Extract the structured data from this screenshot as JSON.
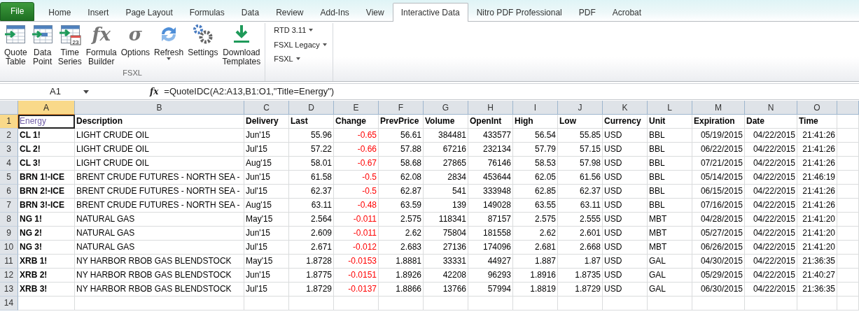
{
  "tabs": [
    {
      "label": "File",
      "kind": "file",
      "selected": false
    },
    {
      "label": "Home",
      "kind": "tab",
      "selected": false
    },
    {
      "label": "Insert",
      "kind": "tab",
      "selected": false
    },
    {
      "label": "Page Layout",
      "kind": "tab",
      "selected": false
    },
    {
      "label": "Formulas",
      "kind": "tab",
      "selected": false
    },
    {
      "label": "Data",
      "kind": "tab",
      "selected": false
    },
    {
      "label": "Review",
      "kind": "tab",
      "selected": false
    },
    {
      "label": "Add-Ins",
      "kind": "tab",
      "selected": false
    },
    {
      "label": "View",
      "kind": "tab",
      "selected": false
    },
    {
      "label": "Interactive Data",
      "kind": "tab",
      "selected": true
    },
    {
      "label": "Nitro PDF Professional",
      "kind": "tab",
      "selected": false
    },
    {
      "label": "PDF",
      "kind": "tab",
      "selected": false
    },
    {
      "label": "Acrobat",
      "kind": "tab",
      "selected": false
    }
  ],
  "ribbon": {
    "group_label": "FSXL",
    "buttons": [
      {
        "label": [
          "Quote",
          "Table"
        ],
        "kind": "table"
      },
      {
        "label": [
          "Data",
          "Point"
        ],
        "kind": "point"
      },
      {
        "label": [
          "Time",
          "Series"
        ],
        "kind": "series",
        "badge": "23"
      },
      {
        "label": [
          "Formula",
          "Builder"
        ],
        "kind": "glyph",
        "glyph": "fx"
      },
      {
        "label": [
          "Options"
        ],
        "kind": "glyph",
        "glyph": "σ"
      },
      {
        "label": [
          "Refresh"
        ],
        "kind": "refresh",
        "dropdown": true
      },
      {
        "label": [
          "Settings"
        ],
        "kind": "gears"
      },
      {
        "label": [
          "Download",
          "Templates"
        ],
        "kind": "download"
      }
    ],
    "menus": [
      "RTD 3.11",
      "FSXL Legacy",
      "FSXL"
    ]
  },
  "formula_bar": {
    "name_box": "A1",
    "fx": "fx",
    "formula": "=QuoteIDC(A2:A13,B1:O1,\"Title=Energy\")"
  },
  "sheet": {
    "columns": [
      {
        "letter": "A",
        "kind": "label",
        "selected": true
      },
      {
        "letter": "B",
        "kind": "text",
        "selected": false
      },
      {
        "letter": "C",
        "kind": "text",
        "selected": false
      },
      {
        "letter": "D",
        "kind": "number",
        "selected": false
      },
      {
        "letter": "E",
        "kind": "change",
        "selected": false
      },
      {
        "letter": "F",
        "kind": "number",
        "selected": false
      },
      {
        "letter": "G",
        "kind": "number",
        "selected": false
      },
      {
        "letter": "H",
        "kind": "number",
        "selected": false
      },
      {
        "letter": "I",
        "kind": "number",
        "selected": false
      },
      {
        "letter": "J",
        "kind": "number",
        "selected": false
      },
      {
        "letter": "K",
        "kind": "text",
        "selected": false
      },
      {
        "letter": "L",
        "kind": "text",
        "selected": false
      },
      {
        "letter": "M",
        "kind": "number",
        "selected": false
      },
      {
        "letter": "N",
        "kind": "number",
        "selected": false
      },
      {
        "letter": "O",
        "kind": "number",
        "selected": false
      }
    ],
    "rows": [
      {
        "number": "1",
        "kind": "header",
        "selected": true,
        "cells": [
          "Energy",
          "Description",
          "Delivery",
          "Last",
          "Change",
          "PrevPrice",
          "Volume",
          "OpenInt",
          "High",
          "Low",
          "Currency",
          "Unit",
          "Expiration",
          "Date",
          "Time"
        ]
      },
      {
        "number": "2",
        "kind": "data",
        "selected": false,
        "cells": [
          "CL 1!",
          "LIGHT CRUDE OIL",
          "Jun'15",
          "55.96",
          "-0.65",
          "56.61",
          "384481",
          "433577",
          "56.54",
          "55.85",
          "USD",
          "BBL",
          "05/19/2015",
          "04/22/2015",
          "21:41:26"
        ]
      },
      {
        "number": "3",
        "kind": "data",
        "selected": false,
        "cells": [
          "CL 2!",
          "LIGHT CRUDE OIL",
          "Jul'15",
          "57.22",
          "-0.66",
          "57.88",
          "67216",
          "232134",
          "57.79",
          "57.15",
          "USD",
          "BBL",
          "06/22/2015",
          "04/22/2015",
          "21:41:26"
        ]
      },
      {
        "number": "4",
        "kind": "data",
        "selected": false,
        "cells": [
          "CL 3!",
          "LIGHT CRUDE OIL",
          "Aug'15",
          "58.01",
          "-0.67",
          "58.68",
          "27865",
          "76146",
          "58.53",
          "57.98",
          "USD",
          "BBL",
          "07/21/2015",
          "04/22/2015",
          "21:41:26"
        ]
      },
      {
        "number": "5",
        "kind": "data",
        "selected": false,
        "cells": [
          "BRN 1!-ICE",
          "BRENT CRUDE FUTURES - NORTH SEA -",
          "Jun'15",
          "61.58",
          "-0.5",
          "62.08",
          "2834",
          "453644",
          "62.05",
          "61.56",
          "USD",
          "BBL",
          "05/14/2015",
          "04/22/2015",
          "21:46:19"
        ]
      },
      {
        "number": "6",
        "kind": "data",
        "selected": false,
        "cells": [
          "BRN 2!-ICE",
          "BRENT CRUDE FUTURES - NORTH SEA -",
          "Jul'15",
          "62.37",
          "-0.5",
          "62.87",
          "541",
          "333948",
          "62.85",
          "62.37",
          "USD",
          "BBL",
          "06/15/2015",
          "04/22/2015",
          "21:41:26"
        ]
      },
      {
        "number": "7",
        "kind": "data",
        "selected": false,
        "cells": [
          "BRN 3!-ICE",
          "BRENT CRUDE FUTURES - NORTH SEA -",
          "Aug'15",
          "63.11",
          "-0.48",
          "63.59",
          "139",
          "149028",
          "63.55",
          "63.11",
          "USD",
          "BBL",
          "07/16/2015",
          "04/22/2015",
          "21:41:26"
        ]
      },
      {
        "number": "8",
        "kind": "data",
        "selected": false,
        "cells": [
          "NG 1!",
          "NATURAL GAS",
          "May'15",
          "2.564",
          "-0.011",
          "2.575",
          "118341",
          "87157",
          "2.575",
          "2.555",
          "USD",
          "MBT",
          "04/28/2015",
          "04/22/2015",
          "21:41:20"
        ]
      },
      {
        "number": "9",
        "kind": "data",
        "selected": false,
        "cells": [
          "NG 2!",
          "NATURAL GAS",
          "Jun'15",
          "2.609",
          "-0.011",
          "2.62",
          "75804",
          "181558",
          "2.62",
          "2.601",
          "USD",
          "MBT",
          "05/27/2015",
          "04/22/2015",
          "21:41:20"
        ]
      },
      {
        "number": "10",
        "kind": "data",
        "selected": false,
        "cells": [
          "NG 3!",
          "NATURAL GAS",
          "Jul'15",
          "2.671",
          "-0.012",
          "2.683",
          "27136",
          "174096",
          "2.681",
          "2.668",
          "USD",
          "MBT",
          "06/26/2015",
          "04/22/2015",
          "21:41:20"
        ]
      },
      {
        "number": "11",
        "kind": "data",
        "selected": false,
        "cells": [
          "XRB 1!",
          "NY HARBOR RBOB GAS BLENDSTOCK",
          "May'15",
          "1.8728",
          "-0.0153",
          "1.8881",
          "33331",
          "44927",
          "1.887",
          "1.87",
          "USD",
          "GAL",
          "04/30/2015",
          "04/22/2015",
          "21:36:35"
        ]
      },
      {
        "number": "12",
        "kind": "data",
        "selected": false,
        "cells": [
          "XRB 2!",
          "NY HARBOR RBOB GAS BLENDSTOCK",
          "Jun'15",
          "1.8775",
          "-0.0151",
          "1.8926",
          "42208",
          "96293",
          "1.8916",
          "1.8735",
          "USD",
          "GAL",
          "05/29/2015",
          "04/22/2015",
          "21:40:27"
        ]
      },
      {
        "number": "13",
        "kind": "data",
        "selected": false,
        "cells": [
          "XRB 3!",
          "NY HARBOR RBOB GAS BLENDSTOCK",
          "Jul'15",
          "1.8729",
          "-0.0137",
          "1.8866",
          "13766",
          "57994",
          "1.8819",
          "1.8729",
          "USD",
          "GAL",
          "06/30/2015",
          "04/22/2015",
          "21:36:35"
        ]
      },
      {
        "number": "14",
        "kind": "empty",
        "selected": false,
        "cells": []
      }
    ]
  }
}
